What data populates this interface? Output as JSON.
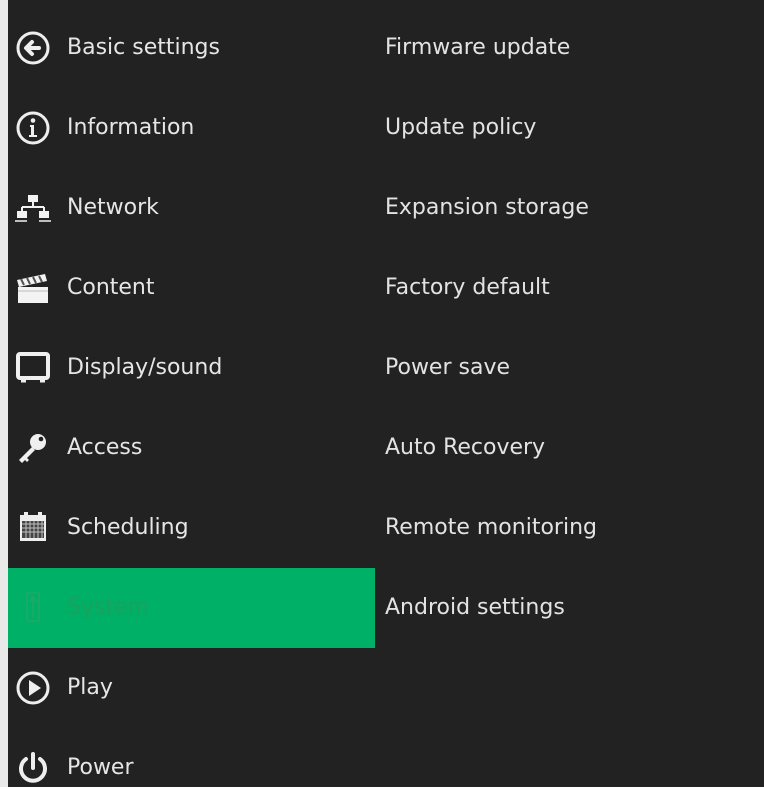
{
  "main_menu": {
    "items": [
      {
        "label": "Basic settings",
        "icon": "back-arrow-icon",
        "selected": false
      },
      {
        "label": "Information",
        "icon": "info-icon",
        "selected": false
      },
      {
        "label": "Network",
        "icon": "network-icon",
        "selected": false
      },
      {
        "label": "Content",
        "icon": "clapperboard-icon",
        "selected": false
      },
      {
        "label": "Display/sound",
        "icon": "display-icon",
        "selected": false
      },
      {
        "label": "Access",
        "icon": "key-icon",
        "selected": false
      },
      {
        "label": "Scheduling",
        "icon": "calendar-icon",
        "selected": false
      },
      {
        "label": "System",
        "icon": "system-icon",
        "selected": true
      },
      {
        "label": "Play",
        "icon": "play-icon",
        "selected": false
      },
      {
        "label": "Power",
        "icon": "power-icon",
        "selected": false
      }
    ]
  },
  "system_submenu": {
    "items": [
      {
        "label": "Firmware update"
      },
      {
        "label": "Update policy"
      },
      {
        "label": "Expansion storage"
      },
      {
        "label": "Factory default"
      },
      {
        "label": "Power save"
      },
      {
        "label": "Auto Recovery"
      },
      {
        "label": "Remote monitoring"
      },
      {
        "label": "Android settings"
      }
    ]
  },
  "colors": {
    "background": "#222222",
    "selected_row": "#00b067",
    "selected_text": "#1aa15d",
    "text": "#e6e6e6",
    "outer_border": "#e9e9e9"
  }
}
